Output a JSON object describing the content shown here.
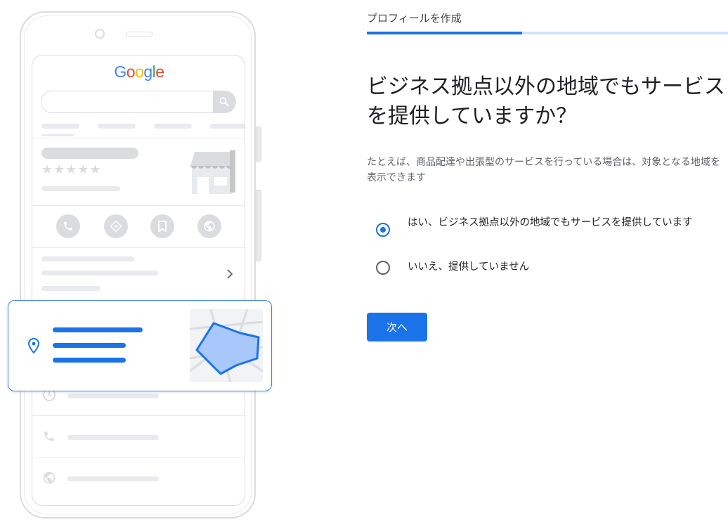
{
  "illustration": {
    "logo_letters": [
      {
        "ch": "G",
        "color": "#4285f4"
      },
      {
        "ch": "o",
        "color": "#ea4335"
      },
      {
        "ch": "o",
        "color": "#fbbc05"
      },
      {
        "ch": "g",
        "color": "#4285f4"
      },
      {
        "ch": "l",
        "color": "#34a853"
      },
      {
        "ch": "e",
        "color": "#ea4335"
      }
    ],
    "stars": "★★★★★",
    "rating_stars": 5
  },
  "form": {
    "step_label": "プロフィールを作成",
    "progress": 0.43,
    "heading": "ビジネス拠点以外の地域でもサービスを提供していますか？",
    "description": "たとえば、商品配達や出張型のサービスを行っている場合は、対象となる地域を表示できます",
    "options": [
      {
        "label": "はい、ビジネス拠点以外の地域でもサービスを提供しています",
        "selected": true
      },
      {
        "label": "いいえ、提供していません",
        "selected": false
      }
    ],
    "next_label": "次へ"
  },
  "colors": {
    "accent": "#1a73e8",
    "track": "#d2e3fc",
    "map_polygon": "#a8c7fa"
  }
}
